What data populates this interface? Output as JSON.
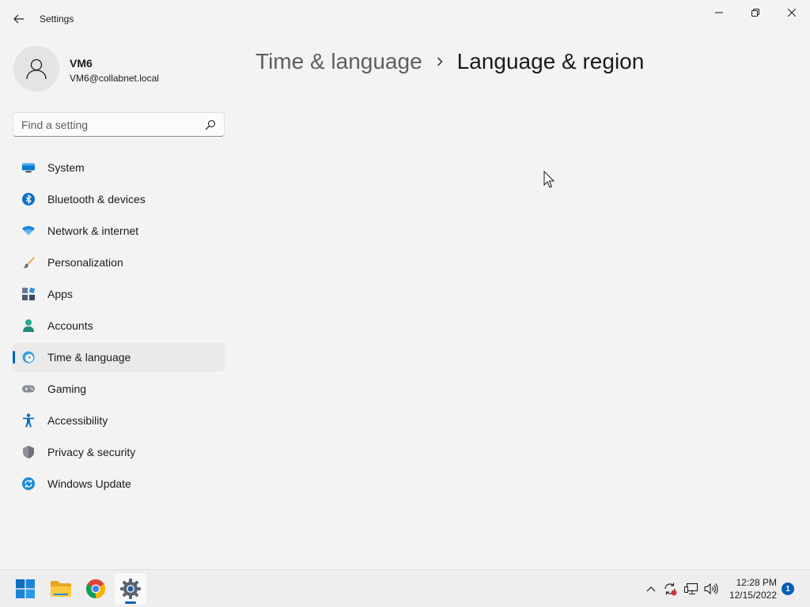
{
  "window": {
    "title": "Settings"
  },
  "profile": {
    "name": "VM6",
    "email": "VM6@collabnet.local"
  },
  "search": {
    "placeholder": "Find a setting",
    "value": ""
  },
  "nav": {
    "items": [
      {
        "label": "System",
        "icon": "system-icon"
      },
      {
        "label": "Bluetooth & devices",
        "icon": "bluetooth-icon"
      },
      {
        "label": "Network & internet",
        "icon": "wifi-icon"
      },
      {
        "label": "Personalization",
        "icon": "brush-icon"
      },
      {
        "label": "Apps",
        "icon": "apps-icon"
      },
      {
        "label": "Accounts",
        "icon": "account-icon"
      },
      {
        "label": "Time & language",
        "icon": "time-language-icon",
        "selected": true
      },
      {
        "label": "Gaming",
        "icon": "gamepad-icon"
      },
      {
        "label": "Accessibility",
        "icon": "accessibility-icon"
      },
      {
        "label": "Privacy & security",
        "icon": "shield-icon"
      },
      {
        "label": "Windows Update",
        "icon": "update-icon"
      }
    ]
  },
  "breadcrumb": {
    "parent": "Time & language",
    "current": "Language & region"
  },
  "taskbar": {
    "apps": [
      {
        "name": "Start",
        "icon": "windows-logo-icon"
      },
      {
        "name": "File Explorer",
        "icon": "folder-icon"
      },
      {
        "name": "Chrome",
        "icon": "chrome-icon"
      },
      {
        "name": "Settings",
        "icon": "settings-gear-icon",
        "active": true
      }
    ],
    "time": "12:28 PM",
    "date": "12/15/2022",
    "notification_count": "1"
  },
  "colors": {
    "accent": "#005fb8",
    "background": "#f3f3f3",
    "selected_item": "#eaeaea"
  }
}
